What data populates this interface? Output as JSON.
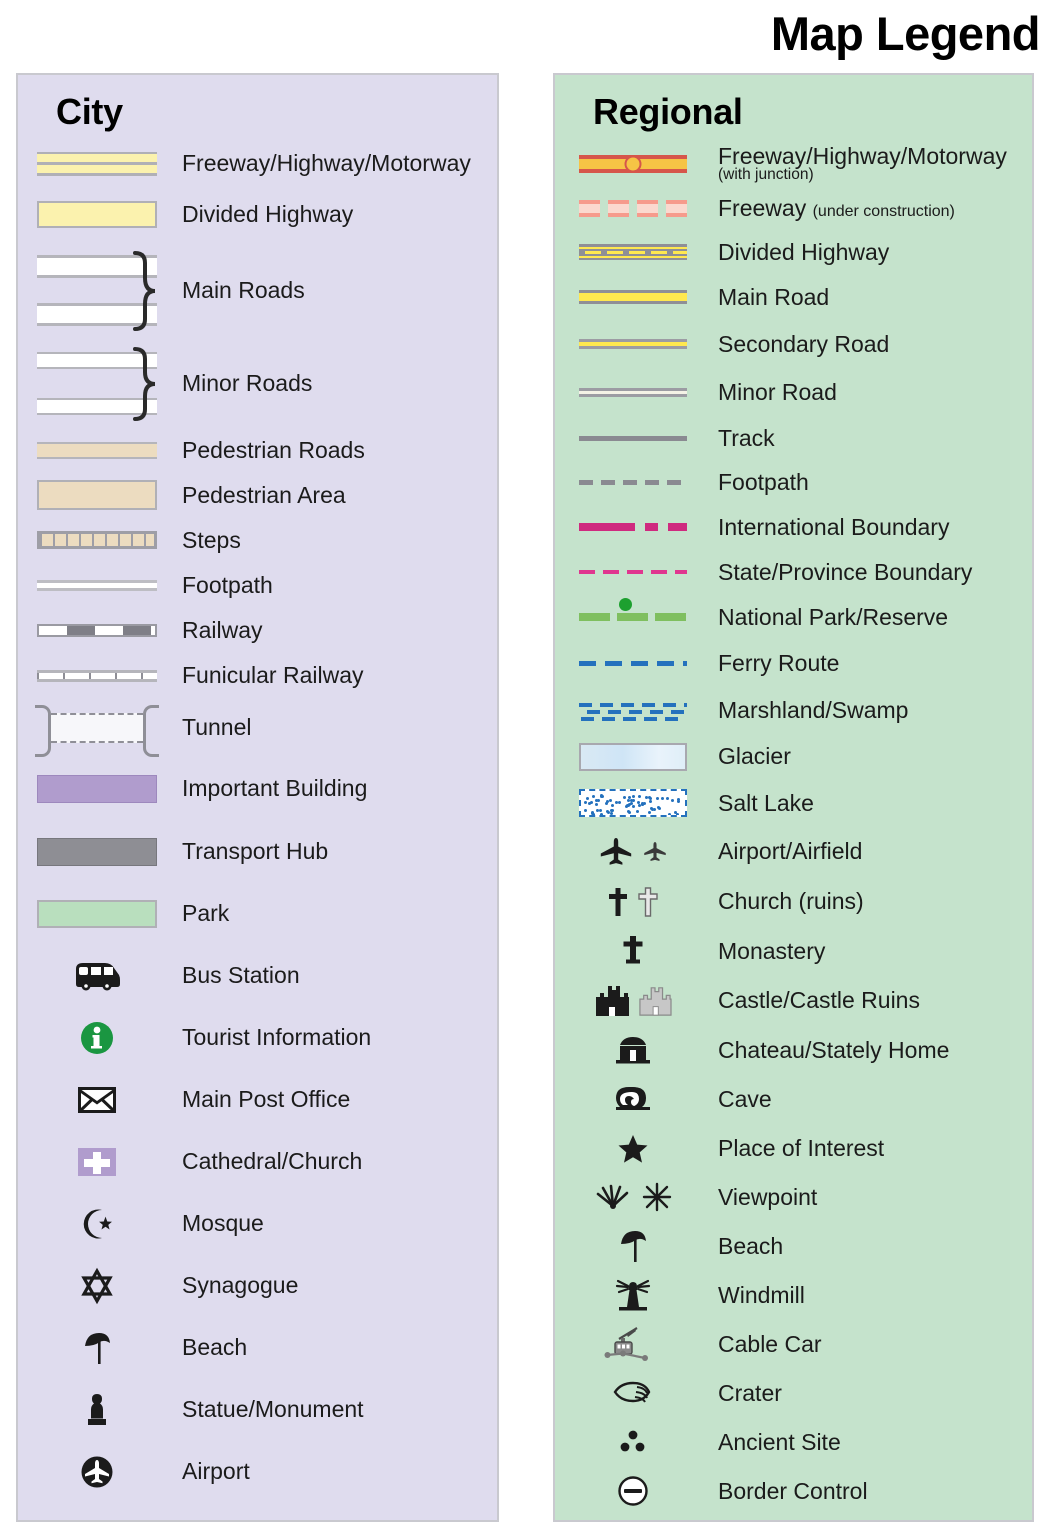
{
  "title": "Map Legend",
  "panels": {
    "city": {
      "heading": "City",
      "background_color": "#dfdcee",
      "items": [
        {
          "label": "Freeway/Highway/Motorway",
          "symbol": "highway-double-band"
        },
        {
          "label": "Divided Highway",
          "symbol": "divided-highway-band"
        },
        {
          "label": "Main Roads",
          "symbol": "white-road-pair-braced"
        },
        {
          "label": "Minor Roads",
          "symbol": "white-road-thin-pair-braced"
        },
        {
          "label": "Pedestrian Roads",
          "symbol": "pedestrian-road-band"
        },
        {
          "label": "Pedestrian Area",
          "symbol": "pedestrian-area-block"
        },
        {
          "label": "Steps",
          "symbol": "steps-band"
        },
        {
          "label": "Footpath",
          "symbol": "footpath-line"
        },
        {
          "label": "Railway",
          "symbol": "railway-hatched-line"
        },
        {
          "label": "Funicular Railway",
          "symbol": "funicular-tick-line"
        },
        {
          "label": "Tunnel",
          "symbol": "tunnel-bracket-dashed"
        },
        {
          "label": "Important Building",
          "symbol": "purple-block"
        },
        {
          "label": "Transport Hub",
          "symbol": "gray-block"
        },
        {
          "label": "Park",
          "symbol": "green-block"
        },
        {
          "label": "Bus Station",
          "symbol": "bus-icon"
        },
        {
          "label": "Tourist Information",
          "symbol": "information-circle-icon"
        },
        {
          "label": "Main Post Office",
          "symbol": "envelope-icon"
        },
        {
          "label": "Cathedral/Church",
          "symbol": "cross-on-purple-icon"
        },
        {
          "label": "Mosque",
          "symbol": "crescent-star-icon"
        },
        {
          "label": "Synagogue",
          "symbol": "star-of-david-icon"
        },
        {
          "label": "Beach",
          "symbol": "parasol-icon"
        },
        {
          "label": "Statue/Monument",
          "symbol": "statue-icon"
        },
        {
          "label": "Airport",
          "symbol": "airplane-circle-icon"
        }
      ]
    },
    "regional": {
      "heading": "Regional",
      "background_color": "#c5e3cc",
      "items": [
        {
          "label": "Freeway/Highway/Motorway",
          "sublabel": "(with junction)",
          "sublabel_position": "below",
          "symbol": "freeway-junction-line"
        },
        {
          "label": "Freeway",
          "sublabel": "(under construction)",
          "sublabel_position": "inline",
          "symbol": "freeway-dashed-line"
        },
        {
          "label": "Divided Highway",
          "symbol": "divided-highway-line"
        },
        {
          "label": "Main Road",
          "symbol": "main-road-line"
        },
        {
          "label": "Secondary Road",
          "symbol": "secondary-road-line"
        },
        {
          "label": "Minor Road",
          "symbol": "minor-road-line"
        },
        {
          "label": "Track",
          "symbol": "track-line"
        },
        {
          "label": "Footpath",
          "symbol": "footpath-dashed-line"
        },
        {
          "label": "International Boundary",
          "symbol": "international-boundary-line"
        },
        {
          "label": "State/Province Boundary",
          "symbol": "state-boundary-line"
        },
        {
          "label": "National Park/Reserve",
          "symbol": "national-park-line"
        },
        {
          "label": "Ferry Route",
          "symbol": "ferry-route-line"
        },
        {
          "label": "Marshland/Swamp",
          "symbol": "marshland-pattern"
        },
        {
          "label": "Glacier",
          "symbol": "glacier-block"
        },
        {
          "label": "Salt Lake",
          "symbol": "salt-lake-block"
        },
        {
          "label": "Airport/Airfield",
          "symbol": "airplane-pair-icon"
        },
        {
          "label": "Church (ruins)",
          "symbol": "cross-pair-icon"
        },
        {
          "label": "Monastery",
          "symbol": "monastery-cross-icon"
        },
        {
          "label": "Castle/Castle Ruins",
          "symbol": "castle-pair-icon"
        },
        {
          "label": "Chateau/Stately Home",
          "symbol": "chateau-icon"
        },
        {
          "label": "Cave",
          "symbol": "cave-icon"
        },
        {
          "label": "Place of Interest",
          "symbol": "star-icon"
        },
        {
          "label": "Viewpoint",
          "symbol": "viewpoint-pair-icon"
        },
        {
          "label": "Beach",
          "symbol": "parasol-icon"
        },
        {
          "label": "Windmill",
          "symbol": "windmill-icon"
        },
        {
          "label": "Cable Car",
          "symbol": "cable-car-icon"
        },
        {
          "label": "Crater",
          "symbol": "crater-icon"
        },
        {
          "label": "Ancient Site",
          "symbol": "ancient-site-dots-icon"
        },
        {
          "label": "Border Control",
          "symbol": "border-control-icon"
        }
      ]
    }
  },
  "colors": {
    "city_panel": "#dfdcee",
    "regional_panel": "#c5e3cc",
    "panel_border": "#c9c9cf",
    "highway_yellow": "#fbf2ae",
    "road_yellow": "#ffe84f",
    "freeway_red": "#d6564b",
    "freeway_orange": "#f6c445",
    "pedestrian_tan": "#ecdcc0",
    "building_purple": "#b09ccd",
    "hub_gray": "#8e8e94",
    "park_green": "#b9dfbe",
    "boundary_magenta": "#cf2a7f",
    "ferry_blue": "#2471bd",
    "park_line_green": "#7fbf5f",
    "info_green": "#1a9641",
    "text": "#1b1b1b"
  }
}
